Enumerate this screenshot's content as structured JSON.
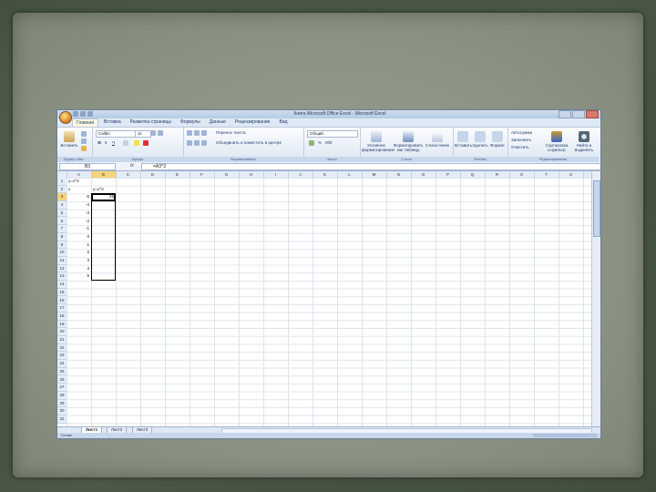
{
  "window": {
    "title": "Книга Microsoft Office Excel - Microsoft Excel"
  },
  "ribbon": {
    "tabs": [
      "Главная",
      "Вставка",
      "Разметка страницы",
      "Формулы",
      "Данные",
      "Рецензирование",
      "Вид"
    ],
    "active_tab": 0,
    "clipboard": {
      "paste": "Вставить",
      "label": "Буфер обм..."
    },
    "font": {
      "name": "Calibri",
      "size": "11",
      "label": "Шрифт"
    },
    "alignment": {
      "wrap": "Перенос текста",
      "merge": "Объединить и поместить в центре",
      "label": "Выравнивание"
    },
    "number": {
      "format": "Общий",
      "label": "Число"
    },
    "styles": {
      "conditional": "Условное форматирование",
      "table": "Форматировать как таблицу",
      "cell": "Стили ячеек",
      "label": "Стили"
    },
    "cells": {
      "insert": "Вставить",
      "delete": "Удалить",
      "format": "Формат",
      "label": "Ячейки"
    },
    "editing": {
      "autosum": "Автосумма",
      "fill": "Заполнить",
      "clear": "Очистить",
      "sort": "Сортировка и фильтр",
      "find": "Найти и выделить",
      "label": "Редактирование"
    }
  },
  "formula_bar": {
    "name_box": "B3",
    "fx": "fx",
    "formula": "=A3^2"
  },
  "columns": [
    "A",
    "B",
    "C",
    "D",
    "E",
    "F",
    "G",
    "H",
    "I",
    "J",
    "K",
    "L",
    "M",
    "N",
    "O",
    "P",
    "Q",
    "R",
    "S",
    "T",
    "U"
  ],
  "rows": [
    "1",
    "2",
    "3",
    "4",
    "5",
    "6",
    "7",
    "8",
    "9",
    "10",
    "11",
    "12",
    "13",
    "14",
    "15",
    "16",
    "17",
    "18",
    "19",
    "20",
    "21",
    "22",
    "23",
    "24",
    "25",
    "26",
    "27",
    "28",
    "29",
    "30",
    "31"
  ],
  "cells": {
    "A1": "y=x^2",
    "A2": "x",
    "B2": "y=x^2",
    "A3": "-5",
    "B3": "25",
    "A4": "-4",
    "A5": "-3",
    "A6": "-2",
    "A7": "-1",
    "A8": "0",
    "A9": "1",
    "A10": "2",
    "A11": "3",
    "A12": "4",
    "A13": "5"
  },
  "sheets": [
    "Лист1",
    "Лист2",
    "Лист3"
  ],
  "status": {
    "text": "Готово"
  }
}
